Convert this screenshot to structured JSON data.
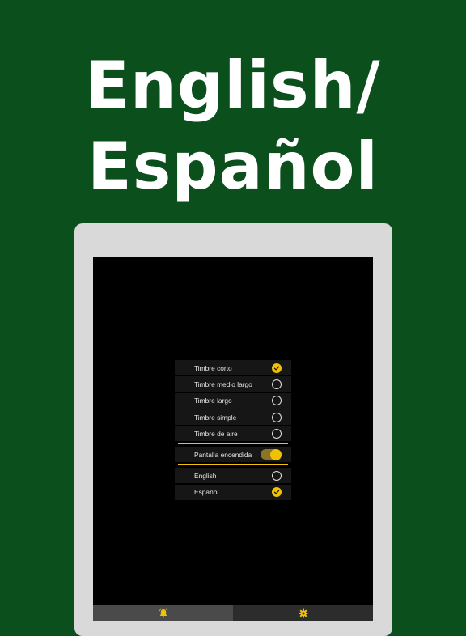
{
  "headline": {
    "line1": "English/",
    "line2": "Español"
  },
  "sounds": [
    {
      "label": "Timbre corto",
      "checked": true
    },
    {
      "label": "Timbre medio largo",
      "checked": false
    },
    {
      "label": "Timbre largo",
      "checked": false
    },
    {
      "label": "Timbre simple",
      "checked": false
    },
    {
      "label": "Timbre de aire",
      "checked": false
    }
  ],
  "screen_on": {
    "label": "Pantalla encendida",
    "enabled": true
  },
  "languages": [
    {
      "label": "English",
      "checked": false
    },
    {
      "label": "Español",
      "checked": true
    }
  ],
  "tabs": [
    {
      "icon": "bell-icon",
      "active": true
    },
    {
      "icon": "gear-icon",
      "active": false
    }
  ],
  "colors": {
    "background": "#0b4f1c",
    "accent": "#f2c200",
    "device_frame": "#d9d9d9"
  }
}
